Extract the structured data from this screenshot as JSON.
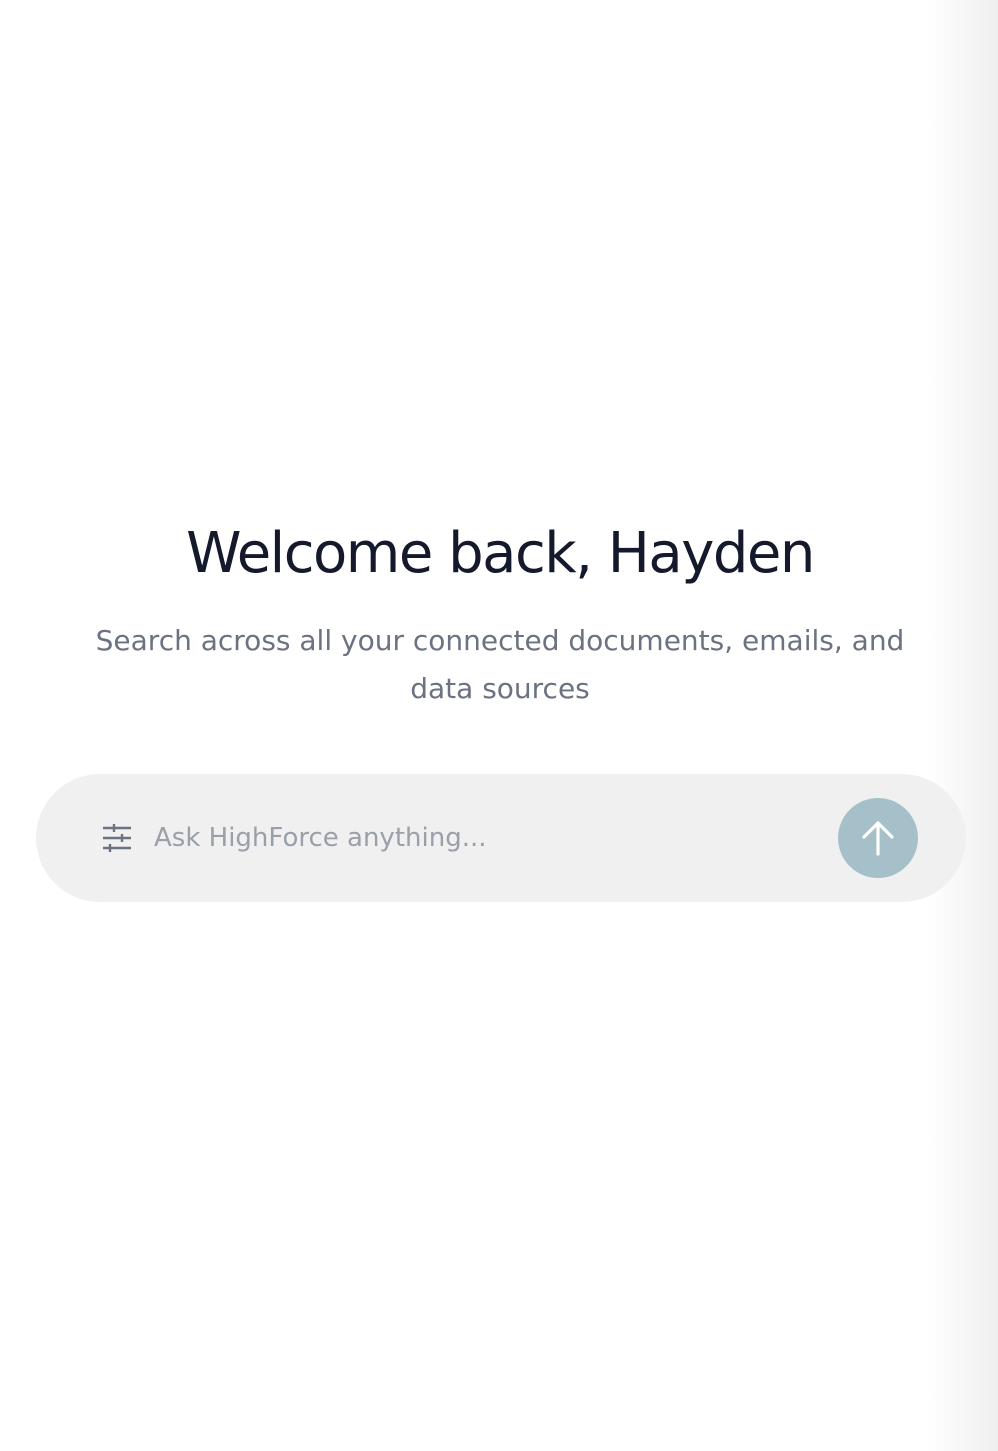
{
  "welcome": {
    "title": "Welcome back, Hayden",
    "subtitle": "Search across all your connected documents, emails, and data sources"
  },
  "search": {
    "placeholder": "Ask HighForce anything...",
    "value": "",
    "filter_icon": "sliders-icon",
    "submit_icon": "arrow-up-icon"
  },
  "colors": {
    "background": "#ffffff",
    "title": "#141a2b",
    "subtitle": "#6b7280",
    "search_bar_background": "#f0f0f0",
    "placeholder": "#9aa0aa",
    "send_button": "#a5c0c8"
  }
}
